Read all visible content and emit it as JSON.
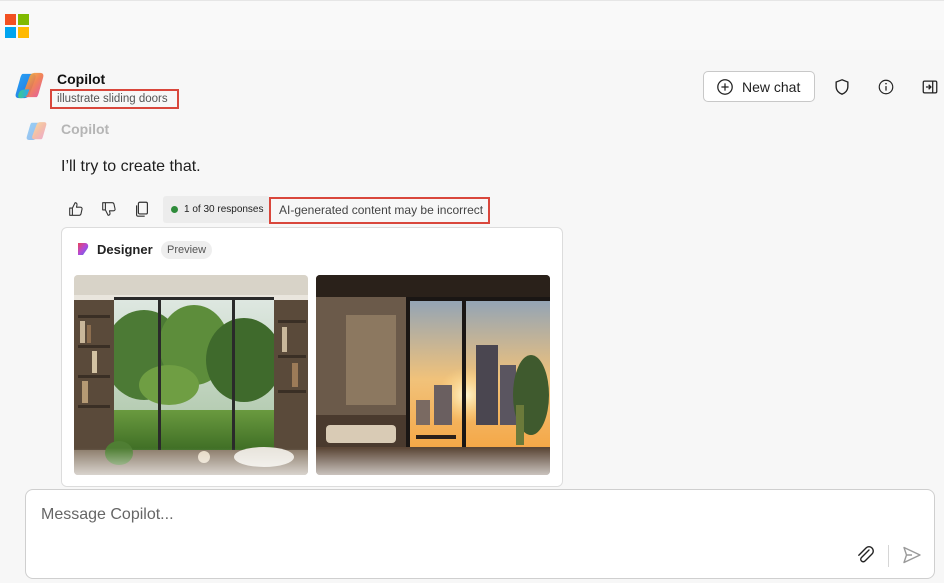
{
  "header": {
    "app_title": "Copilot",
    "chat_subtitle": "illustrate sliding doors",
    "new_chat_label": "New chat"
  },
  "message": {
    "sender": "Copilot",
    "text": "I’ll try to create that.",
    "responses_count": "1 of 30 responses",
    "disclaimer": "AI-generated content may be incorrect"
  },
  "designer": {
    "title": "Designer",
    "badge": "Preview"
  },
  "composer": {
    "placeholder": "Message Copilot..."
  },
  "colors": {
    "highlight_border": "#d9473c",
    "status_dot": "#2e8b3a"
  },
  "icons": {
    "new_chat": "plus-circle-icon",
    "privacy": "shield-icon",
    "info": "info-icon",
    "sidebar": "sidebar-toggle-icon",
    "like": "thumbs-up-icon",
    "dislike": "thumbs-down-icon",
    "copy": "copy-icon",
    "attach": "paperclip-icon",
    "send": "send-icon"
  }
}
